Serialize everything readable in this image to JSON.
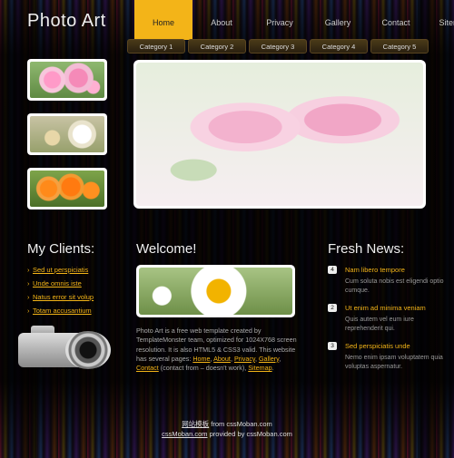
{
  "logo": "Photo Art",
  "nav": [
    "Home",
    "About",
    "Privacy",
    "Gallery",
    "Contact",
    "Sitemap"
  ],
  "categories": [
    "Category 1",
    "Category 2",
    "Category 3",
    "Category 4",
    "Category 5"
  ],
  "clients": {
    "title": "My Clients:",
    "items": [
      "Sed ut perspiciatis",
      "Unde omnis iste",
      "Natus error sit volup",
      "Totam accusantium"
    ]
  },
  "welcome": {
    "title": "Welcome!",
    "text_before": "Photo Art is a free web template created by TemplateMonster team, optimized for 1024X768 screen resolution. It is also HTML5 & CSS3 valid. This website has several pages: ",
    "link_home": "Home",
    "link_about": "About",
    "link_privacy": "Privacy",
    "link_gallery": "Gallery",
    "link_contact": "Contact",
    "text_contact_note": " (contact from – doesn't work), ",
    "link_sitemap": "Sitemap",
    "sep": ", ",
    "end": "."
  },
  "news": {
    "title": "Fresh News:",
    "items": [
      {
        "num": "4",
        "title": "Nam libero tempore",
        "body": "Cum soluta nobis est eligendi optio cumque."
      },
      {
        "num": "2",
        "title": "Ut enim ad minima veniam",
        "body": "Quis autem vel eum iure reprehenderit qui."
      },
      {
        "num": "3",
        "title": "Sed perspiciatis unde",
        "body": "Nemo enim ipsam voluptatem quia voluptas aspernatur."
      }
    ]
  },
  "footer": {
    "line1_link": "网站模板",
    "line1_rest": " from cssMoban.com",
    "line2_link": "cssMoban.com",
    "line2_rest": " provided by cssMoban.com"
  },
  "colors": {
    "accent": "#f3b418",
    "background": "#000000"
  }
}
